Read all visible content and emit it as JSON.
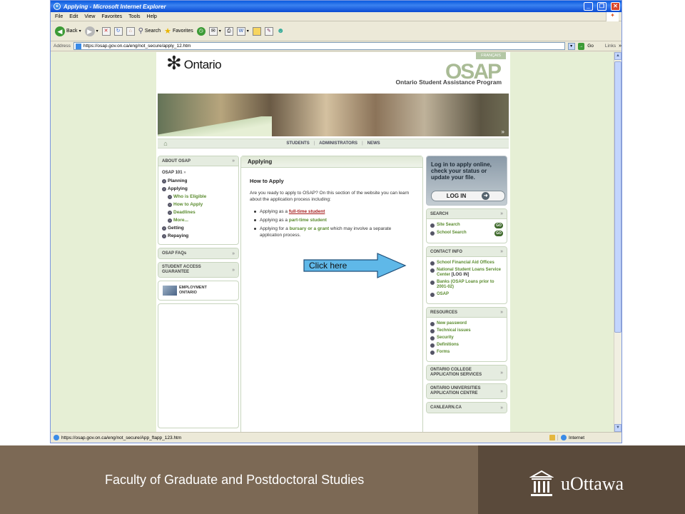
{
  "browser": {
    "title": "Applying - Microsoft Internet Explorer",
    "menu": [
      "File",
      "Edit",
      "View",
      "Favorites",
      "Tools",
      "Help"
    ],
    "toolbar": {
      "back": "Back",
      "search": "Search",
      "favorites": "Favorites"
    },
    "address_label": "Address",
    "address": "https://osap.gov.on.ca/eng/not_secure/apply_12.htm",
    "go": "Go",
    "links": "Links",
    "status_url": "https://osap.gov.on.ca/eng/not_secure/App_ftapp_123.htm",
    "status_zone": "Internet"
  },
  "site": {
    "francais": "FRANÇAIS",
    "ontario": "Ontario",
    "osap_logo": "OSAP",
    "osap_subtitle": "Ontario Student Assistance Program",
    "nav": [
      "STUDENTS",
      "ADMINISTRATORS",
      "NEWS"
    ],
    "left": {
      "about_head": "ABOUT OSAP",
      "osap101": "OSAP 101",
      "items": [
        {
          "label": "Planning",
          "sub": false
        },
        {
          "label": "Applying",
          "sub": false
        },
        {
          "label": "Who is Eligible",
          "sub": true
        },
        {
          "label": "How to Apply",
          "sub": true
        },
        {
          "label": "Deadlines",
          "sub": true
        },
        {
          "label": "More...",
          "sub": true
        },
        {
          "label": "Getting",
          "sub": false
        },
        {
          "label": "Repaying",
          "sub": false
        }
      ],
      "faqs": "OSAP FAQs",
      "guarantee": "STUDENT ACCESS GUARANTEE",
      "employment": "EMPLOYMENT ONTARIO"
    },
    "main": {
      "head": "Applying",
      "heading": "How to Apply",
      "intro": "Are you ready to apply to OSAP? On this section of the website you can learn about the application process including:",
      "bullets": [
        {
          "pre": "Applying as a ",
          "link": "full-time student",
          "post": ""
        },
        {
          "pre": "Applying as a ",
          "link": "part-time student",
          "post": ""
        },
        {
          "pre": "Applying for a ",
          "link": "bursary or a grant",
          "post": " which may involve a separate application process."
        }
      ]
    },
    "right": {
      "login_msg": "Log in to apply online, check your status or update your file.",
      "login_btn": "LOG IN",
      "search_head": "SEARCH",
      "search_items": [
        "Site Search",
        "School Search"
      ],
      "go": "GO",
      "contact_head": "CONTACT INFO",
      "contact_items": [
        {
          "label": "School Financial Aid Offices",
          "extra": ""
        },
        {
          "label": "National Student Loans Service Center",
          "extra": " [LOG IN]"
        },
        {
          "label": "Banks",
          "extra": " (OSAP Loans prior to 2001-02)"
        },
        {
          "label": "OSAP",
          "extra": ""
        }
      ],
      "resources_head": "RESOURCES",
      "resources_items": [
        "New password",
        "Technical issues",
        "Security",
        "Definitions",
        "Forms"
      ],
      "college": "ONTARIO COLLEGE APPLICATION SERVICES",
      "university": "ONTARIO UNIVERSITIES APPLICATION CENTRE",
      "canlearn": "CANLEARN.CA"
    }
  },
  "callout": "Click here",
  "footer": {
    "faculty": "Faculty of Graduate and Postdoctoral Studies",
    "uottawa": "uOttawa"
  }
}
